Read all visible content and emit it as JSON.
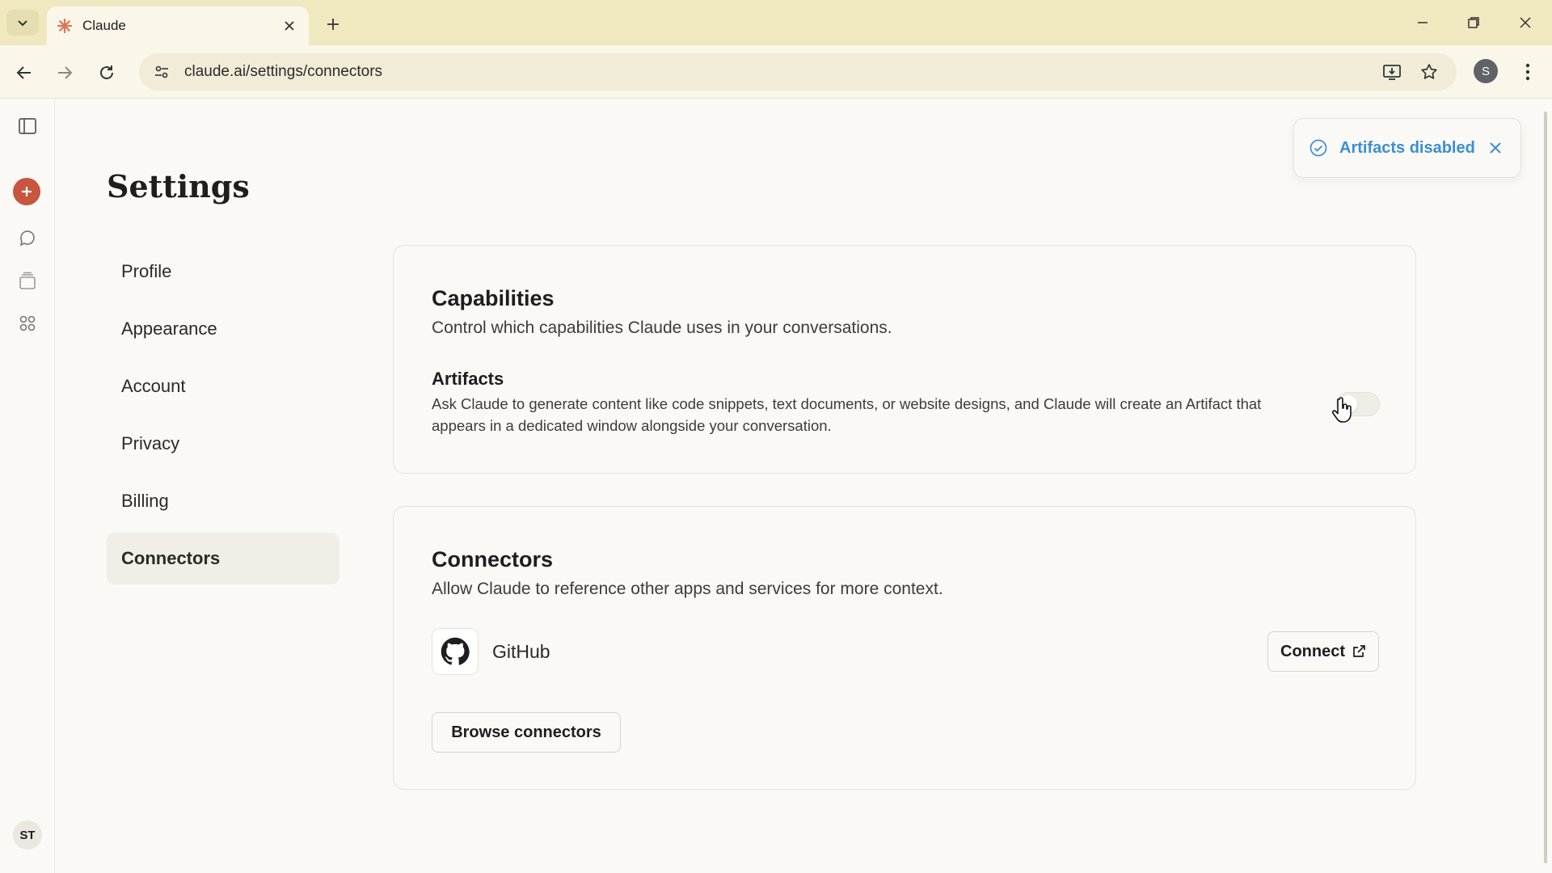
{
  "browser": {
    "tab_title": "Claude",
    "url": "claude.ai/settings/connectors",
    "profile_initial": "S",
    "accent": "#f0e8bf"
  },
  "rail": {
    "user_initials": "ST",
    "new_chat_color": "#c8553d"
  },
  "settings": {
    "title": "Settings",
    "nav": [
      {
        "label": "Profile",
        "active": false
      },
      {
        "label": "Appearance",
        "active": false
      },
      {
        "label": "Account",
        "active": false
      },
      {
        "label": "Privacy",
        "active": false
      },
      {
        "label": "Billing",
        "active": false
      },
      {
        "label": "Connectors",
        "active": true
      }
    ]
  },
  "capabilities": {
    "title": "Capabilities",
    "subtitle": "Control which capabilities Claude uses in your conversations.",
    "artifacts_title": "Artifacts",
    "artifacts_desc": "Ask Claude to generate content like code snippets, text documents, or website designs, and Claude will create an Artifact that appears in a dedicated window alongside your conversation.",
    "artifacts_enabled": false
  },
  "connectors": {
    "title": "Connectors",
    "subtitle": "Allow Claude to reference other apps and services for more context.",
    "github_label": "GitHub",
    "connect_label": "Connect",
    "browse_label": "Browse connectors"
  },
  "toast": {
    "message": "Artifacts disabled",
    "color": "#3a8fd6"
  }
}
